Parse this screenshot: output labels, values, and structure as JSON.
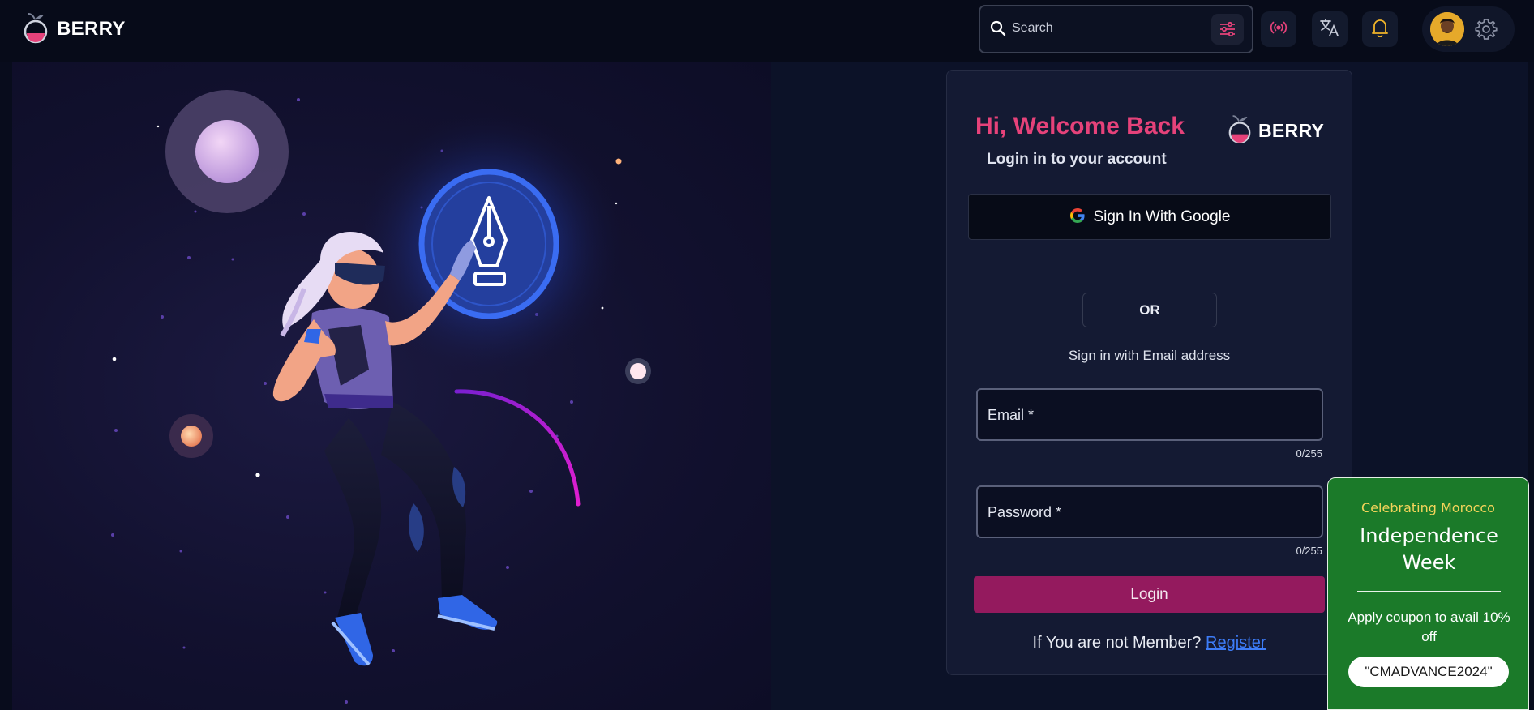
{
  "header": {
    "brand": "BERRY",
    "search_placeholder": "Search",
    "icons": [
      "berry-logo-icon",
      "search-icon",
      "filter-sliders-icon",
      "broadcast-icon",
      "translate-icon",
      "bell-icon",
      "avatar",
      "gear-icon"
    ]
  },
  "login": {
    "greeting": "Hi, Welcome Back",
    "subtitle": "Login in to your account",
    "brand": "BERRY",
    "google_button": "Sign In With Google",
    "or_label": "OR",
    "email_hint": "Sign in with Email address",
    "email_label": "Email *",
    "email_counter": "0/255",
    "password_label": "Password *",
    "password_counter": "0/255",
    "login_button": "Login",
    "register_prompt": "If You are not Member?",
    "register_link": "Register"
  },
  "promo": {
    "line1": "Celebrating Morocco",
    "line2": "Independence Week",
    "line3": "Apply coupon to avail 10% off",
    "coupon": "\"CMADVANCE2024\""
  },
  "colors": {
    "accent_pink": "#e6427a",
    "login_button": "#941a5e",
    "promo_green": "#1b7a29",
    "link_blue": "#3d7cf7"
  }
}
